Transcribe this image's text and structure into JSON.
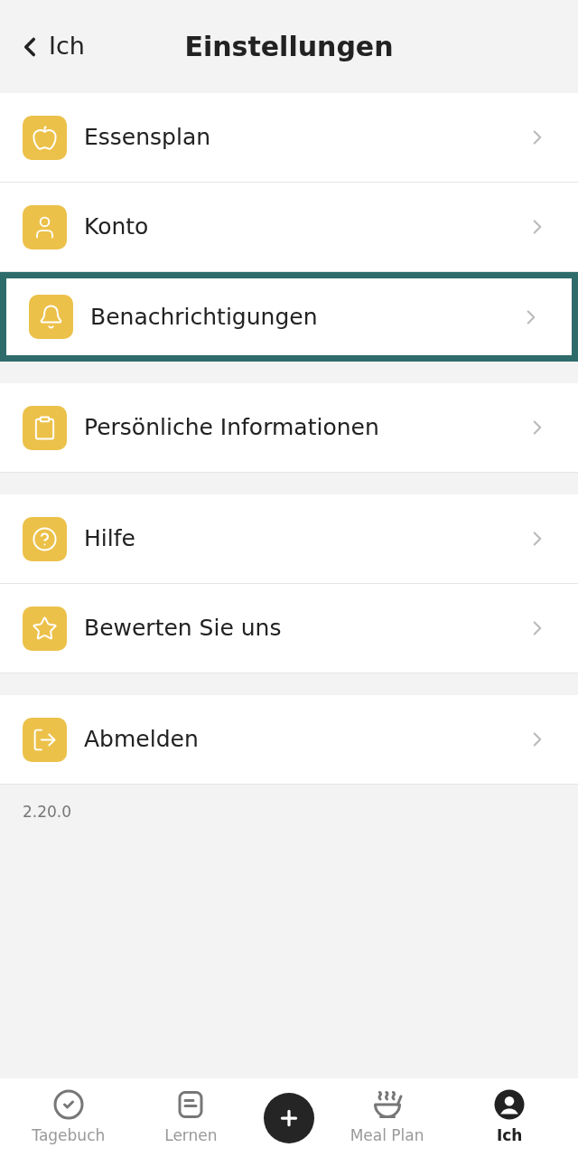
{
  "header": {
    "back_label": "Ich",
    "title": "Einstellungen"
  },
  "groups": [
    {
      "items": [
        {
          "label": "Essensplan",
          "highlighted": false
        },
        {
          "label": "Konto",
          "highlighted": false
        },
        {
          "label": "Benachrichtigungen",
          "highlighted": true
        }
      ]
    },
    {
      "items": [
        {
          "label": "Persönliche Informationen",
          "highlighted": false
        }
      ]
    },
    {
      "items": [
        {
          "label": "Hilfe",
          "highlighted": false
        },
        {
          "label": "Bewerten Sie uns",
          "highlighted": false
        }
      ]
    },
    {
      "items": [
        {
          "label": "Abmelden",
          "highlighted": false
        }
      ]
    }
  ],
  "version": "2.20.0",
  "tab_bar": [
    {
      "label": "Tagebuch",
      "selected": false
    },
    {
      "label": "Lernen",
      "selected": false
    },
    {
      "label": "Meal Plan",
      "selected": false
    },
    {
      "label": "Ich",
      "selected": true
    }
  ]
}
